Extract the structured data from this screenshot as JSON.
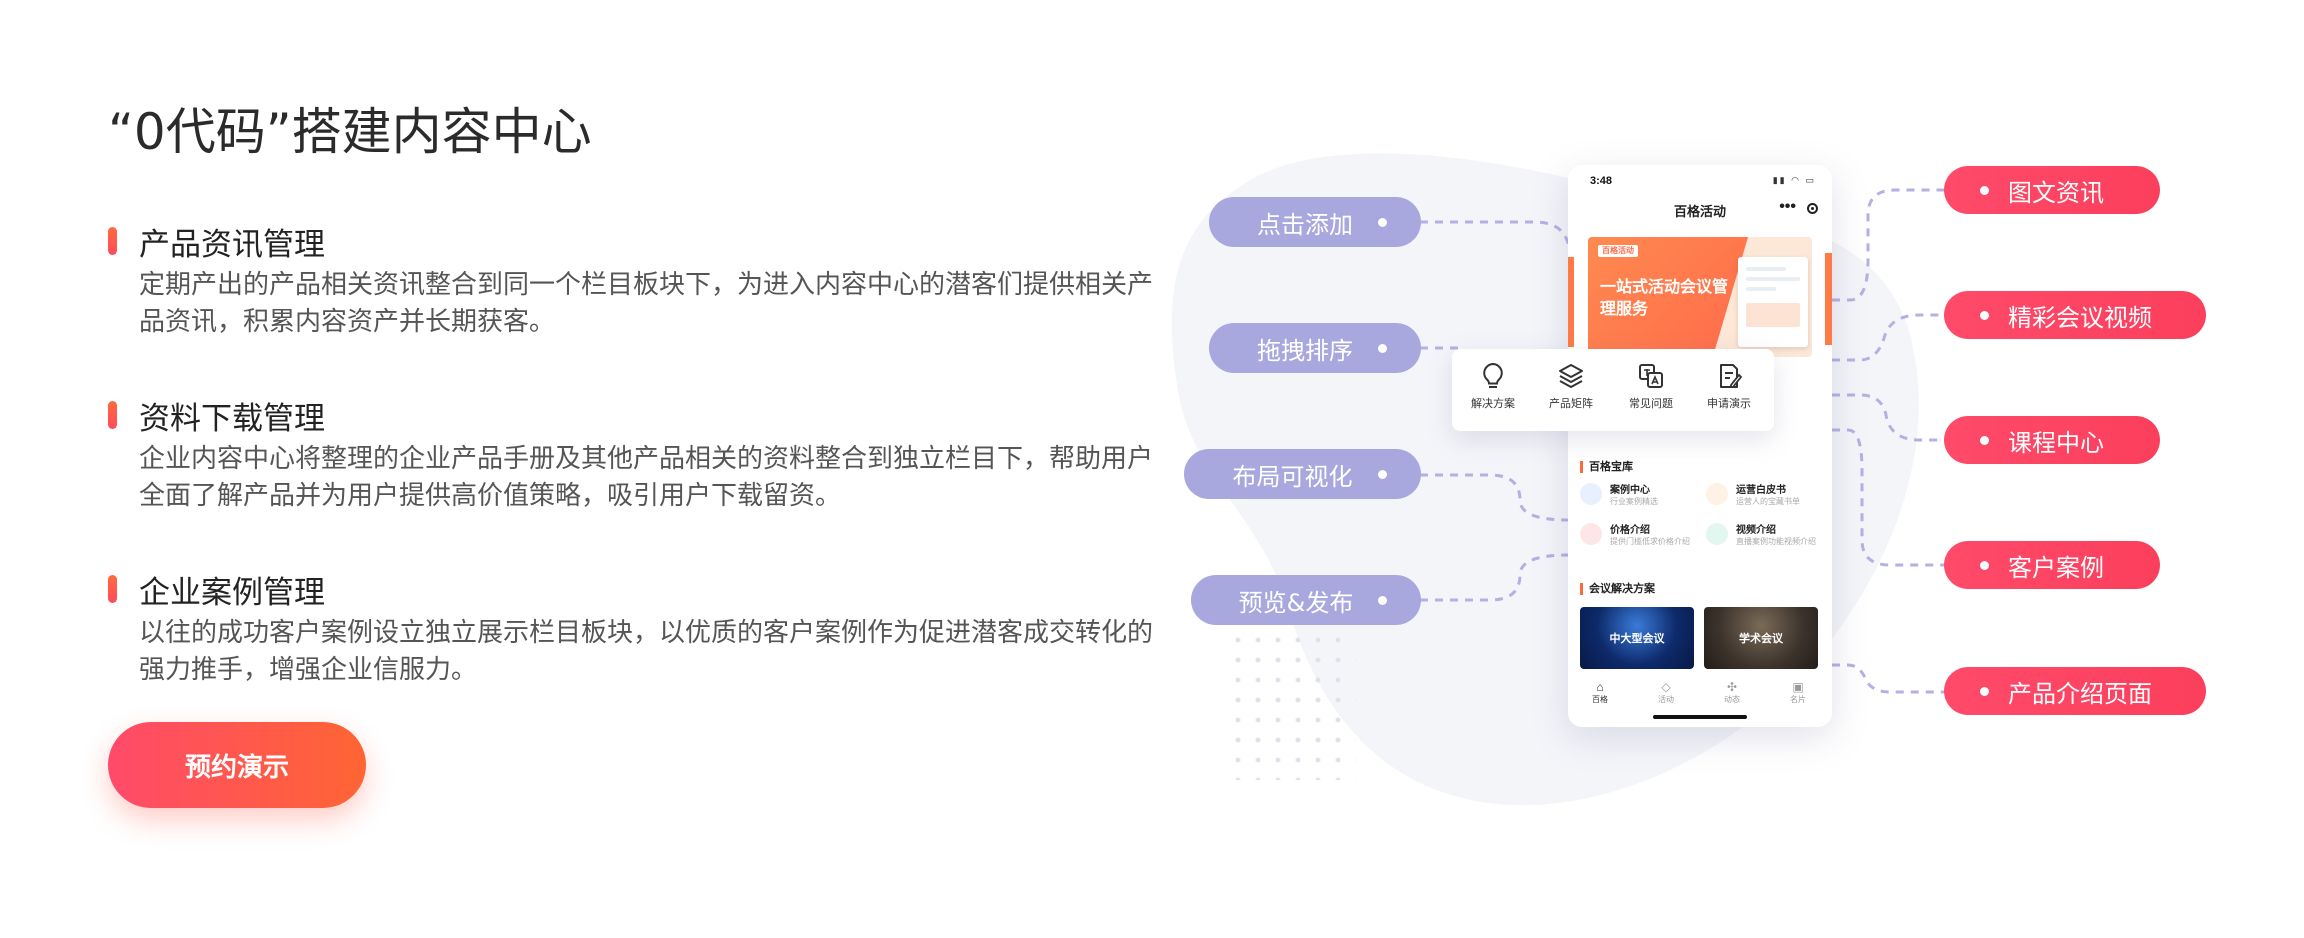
{
  "page_title": "“0代码”搭建内容中心",
  "features": [
    {
      "title": "产品资讯管理",
      "desc": "定期产出的产品相关资讯整合到同一个栏目板块下，为进入内容中心的潜客们提供相关产品资讯，积累内容资产并长期获客。"
    },
    {
      "title": "资料下载管理",
      "desc": "企业内容中心将整理的企业产品手册及其他产品相关的资料整合到独立栏目下，帮助用户全面了解产品并为用户提供高价值策略，吸引用户下载留资。"
    },
    {
      "title": "企业案例管理",
      "desc": "以往的成功客户案例设立独立展示栏目板块，以优质的客户案例作为促进潜客成交转化的强力推手，增强企业信服力。"
    }
  ],
  "cta_label": "预约演示",
  "left_pills": [
    "点击添加",
    "拖拽排序",
    "布局可视化",
    "预览&发布"
  ],
  "right_pills": [
    "图文资讯",
    "精彩会议视频",
    "课程中心",
    "客户案例",
    "产品介绍页面"
  ],
  "phone": {
    "time": "3:48",
    "title": "百格活动",
    "menu": "•••",
    "banner_logo": "百格活动",
    "banner_text": "一站式活动会议管理服务",
    "library_title": "百格宝库",
    "library_items": [
      {
        "name": "案例中心",
        "sub": "行业案例精选",
        "icon_color": "#e8f0ff",
        "icon_name": "bookmark-icon"
      },
      {
        "name": "运营白皮书",
        "sub": "运营人的宝藏书单",
        "icon_color": "#fff1e3",
        "icon_name": "book-icon"
      },
      {
        "name": "价格介绍",
        "sub": "提供门槛低求价格介绍",
        "icon_color": "#ffe6e6",
        "icon_name": "price-tag-icon"
      },
      {
        "name": "视频介绍",
        "sub": "直播案例功能视频介绍",
        "icon_color": "#e2f7f0",
        "icon_name": "video-icon"
      }
    ],
    "solutions_title": "会议解决方案",
    "solutions": [
      "中大型会议",
      "学术会议"
    ],
    "tabs": [
      {
        "label": "百格",
        "icon": "⌂",
        "icon_name": "home-icon"
      },
      {
        "label": "活动",
        "icon": "◇",
        "icon_name": "tag-icon"
      },
      {
        "label": "动态",
        "icon": "✣",
        "icon_name": "activity-icon"
      },
      {
        "label": "名片",
        "icon": "▣",
        "icon_name": "card-icon"
      }
    ]
  },
  "quick_menu": [
    {
      "label": "解决方案",
      "icon": "bulb-icon"
    },
    {
      "label": "产品矩阵",
      "icon": "layers-icon"
    },
    {
      "label": "常见问题",
      "icon": "translate-icon"
    },
    {
      "label": "申请演示",
      "icon": "edit-icon"
    }
  ],
  "colors": {
    "accent_orange": "#ff6533",
    "accent_red": "#ff4a6a",
    "pill_purple": "#a9a8de",
    "connector": "#b3b0e4"
  }
}
